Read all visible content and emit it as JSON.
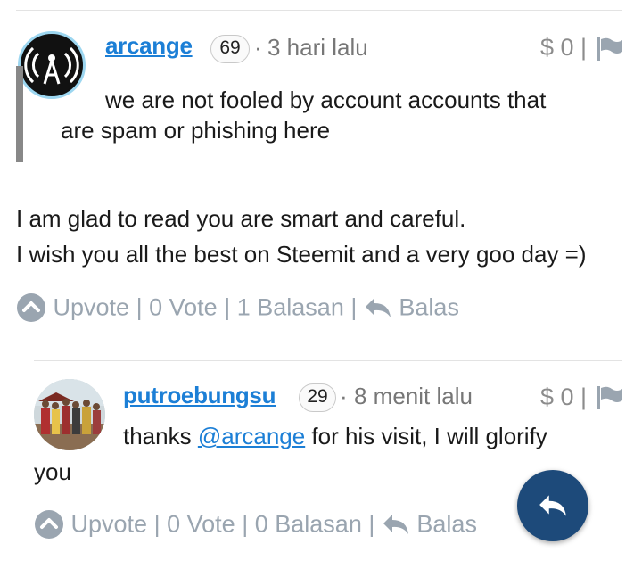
{
  "comment1": {
    "username": "arcange",
    "reputation": "69",
    "separator": "·",
    "time": "3 hari lalu",
    "payout_label": "$ 0 |",
    "quote_line1": "we are not fooled by account accounts that",
    "quote_line2": "are spam or phishing here",
    "body_line1": "I am glad to read you are smart and careful.",
    "body_line2": "I wish you all the best on Steemit and a very goo day =)",
    "actions": {
      "upvote": "Upvote",
      "sep": "|",
      "votes": "0 Vote",
      "replies": "1 Balasan",
      "reply": "Balas"
    }
  },
  "comment2": {
    "username": "putroebungsu",
    "reputation": "29",
    "separator": "·",
    "time": "8 menit lalu",
    "payout_label": "$ 0 |",
    "body_pre": "thanks",
    "mention": "@arcange",
    "body_post": " for his visit, I will glorify",
    "body_line2": "you",
    "actions": {
      "upvote": "Upvote",
      "sep": "|",
      "votes": "0 Vote",
      "replies": "0 Balasan",
      "reply": "Balas"
    }
  },
  "icons": {
    "avatar1": "radio-tower-icon",
    "avatar2": "group-photo-avatar",
    "upvote": "chevron-up-circle-icon",
    "reply": "reply-arrow-icon",
    "flag": "flag-icon",
    "fab": "reply-fab-icon"
  },
  "colors": {
    "link": "#1c7fd6",
    "muted": "#9aa5b0",
    "fab": "#1d4a7a"
  }
}
